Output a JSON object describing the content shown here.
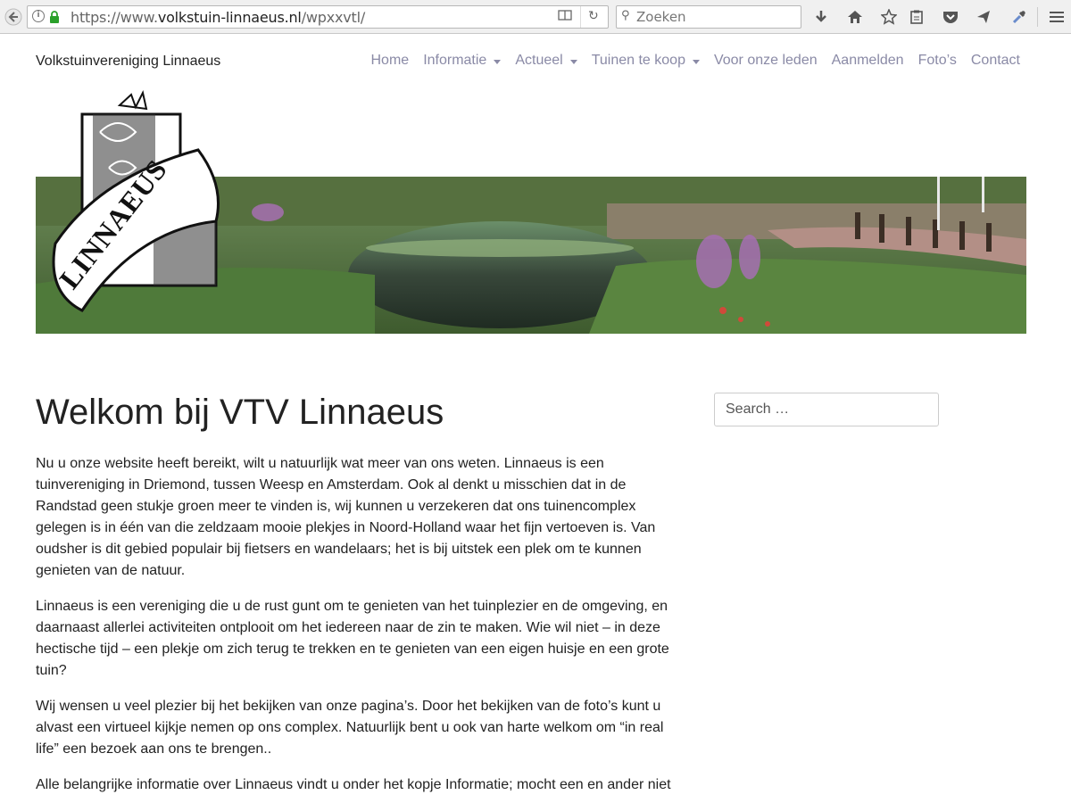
{
  "browser": {
    "url_prefix": "https://www.",
    "url_host": "volkstuin-linnaeus.nl",
    "url_path": "/wpxxvtl/",
    "search_placeholder": "Zoeken",
    "icons": [
      "back-icon",
      "info-icon",
      "lock-icon",
      "reader-view-icon",
      "reload-icon",
      "search-icon",
      "download-icon",
      "home-icon",
      "bookmark-star-icon",
      "clipboard-icon",
      "pocket-icon",
      "send-icon",
      "eyedropper-icon",
      "hamburger-menu-icon"
    ]
  },
  "site": {
    "title": "Volkstuinvereniging Linnaeus",
    "logo_text": "LINNAEUS"
  },
  "nav": {
    "items": [
      {
        "label": "Home",
        "has_dropdown": false
      },
      {
        "label": "Informatie",
        "has_dropdown": true
      },
      {
        "label": "Actueel",
        "has_dropdown": true
      },
      {
        "label": "Tuinen te koop",
        "has_dropdown": true
      },
      {
        "label": "Voor onze leden",
        "has_dropdown": false
      },
      {
        "label": "Aanmelden",
        "has_dropdown": false
      },
      {
        "label": "Foto’s",
        "has_dropdown": false
      },
      {
        "label": "Contact",
        "has_dropdown": false
      }
    ]
  },
  "main": {
    "title": "Welkom bij VTV Linnaeus",
    "paragraphs": [
      "Nu u onze website heeft bereikt, wilt u natuurlijk wat meer van ons weten. Linnaeus is een tuinvereniging in Driemond, tussen Weesp en Amsterdam. Ook al denkt u misschien dat in de Randstad geen stukje groen meer te vinden is, wij kunnen u verzekeren dat ons tuinencomplex gelegen is in één van die zeldzaam mooie plekjes in Noord-Holland waar het fijn vertoeven is. Van oudsher is dit gebied populair bij fietsers en wandelaars; het is bij uitstek een plek om te kunnen genieten van de natuur.",
      "Linnaeus is een vereniging die u de rust gunt om te genieten van het tuinplezier en de omgeving, en daarnaast allerlei activiteiten ontplooit om het iedereen naar de zin te maken. Wie wil niet – in deze hectische tijd – een plekje om zich terug te trekken en te genieten van een eigen huisje en een grote tuin?",
      "Wij wensen u veel plezier bij het bekijken van onze pagina’s. Door het bekijken van de foto’s kunt u alvast een virtueel kijkje nemen op ons complex. Natuurlijk bent u ook van harte welkom om “in real life” een bezoek aan ons te brengen..",
      "Alle belangrijke informatie over Linnaeus vindt u onder het kopje Informatie; mocht een en ander niet"
    ]
  },
  "sidebar": {
    "search_placeholder": "Search …"
  },
  "colors": {
    "nav_text": "#8a8aa6",
    "body_text": "#222222",
    "toolbar_bg": "#f0f0f0"
  }
}
